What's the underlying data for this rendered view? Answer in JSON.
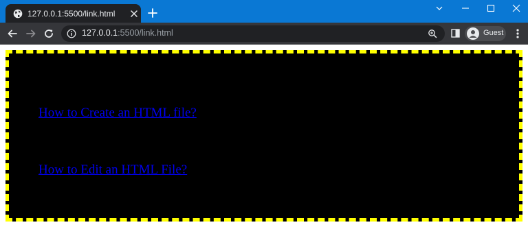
{
  "browser": {
    "tab": {
      "title": "127.0.0.1:5500/link.html",
      "icon": "globe-icon"
    },
    "address_bar": {
      "host": "127.0.0.1",
      "path": ":5500/link.html"
    },
    "profile_label": "Guest",
    "colors": {
      "tabstrip": "#0a78d4",
      "toolbar": "#35363a",
      "active_tab": "#202124"
    }
  },
  "page": {
    "links": [
      {
        "label": "How to Create an HTML file?"
      },
      {
        "label": "How to Edit an HTML File?"
      }
    ],
    "colors": {
      "box_background": "#000000",
      "box_border": "#ffff00",
      "link": "#0000ee"
    }
  }
}
